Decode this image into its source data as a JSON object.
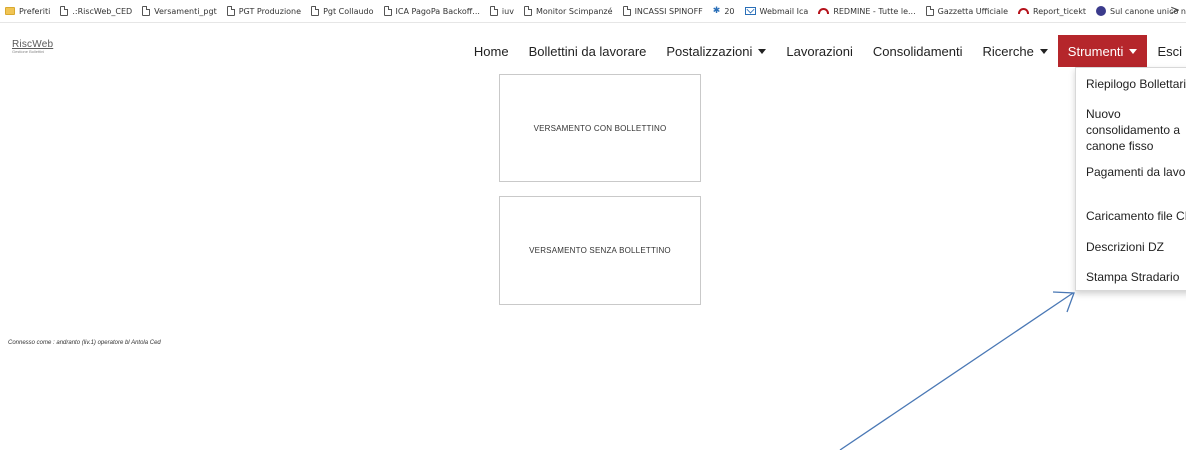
{
  "bookmarks": [
    {
      "label": "Preferiti",
      "icon": "folder-icon"
    },
    {
      "label": ".:RiscWeb_CED",
      "icon": "page-icon"
    },
    {
      "label": "Versamenti_pgt",
      "icon": "page-icon"
    },
    {
      "label": "PGT Produzione",
      "icon": "page-icon"
    },
    {
      "label": "Pgt Collaudo",
      "icon": "page-icon"
    },
    {
      "label": "ICA PagoPa Backoff...",
      "icon": "page-icon"
    },
    {
      "label": "iuv",
      "icon": "page-icon"
    },
    {
      "label": "Monitor Scimpanzé",
      "icon": "page-icon"
    },
    {
      "label": "INCASSI SPINOFF",
      "icon": "page-icon"
    },
    {
      "label": "20",
      "icon": "star-icon"
    },
    {
      "label": "Webmail Ica",
      "icon": "mail-icon"
    },
    {
      "label": "REDMINE - Tutte le...",
      "icon": "redmine-icon"
    },
    {
      "label": "Gazzetta Ufficiale",
      "icon": "page-icon"
    },
    {
      "label": "Report_ticekt",
      "icon": "redmine-icon"
    },
    {
      "label": "Sul canone unico n...",
      "icon": "circle-icon"
    }
  ],
  "bookmarks_more": ">",
  "logo": {
    "main": "RiscWeb",
    "sub": "Gestione Bollettini"
  },
  "nav": {
    "home": "Home",
    "bollettini": "Bollettini da lavorare",
    "postalizzazioni": "Postalizzazioni",
    "lavorazioni": "Lavorazioni",
    "consolidamenti": "Consolidamenti",
    "ricerche": "Ricerche",
    "strumenti": "Strumenti",
    "esci": "Esci"
  },
  "dropdown": [
    "Riepilogo Bollettari",
    "Nuovo consolidamento a canone fisso",
    "Pagamenti da lavorare",
    "Caricamento file CBI",
    "Descrizioni DZ",
    "Stampa Stradario"
  ],
  "cards": {
    "con": "VERSAMENTO CON BOLLETTINO",
    "senza": "VERSAMENTO SENZA BOLLETTINO"
  },
  "status": "Connesso come : andranto (liv.1) operatore bl Antola Ced",
  "colors": {
    "accent": "#b5262b",
    "arrow": "#4a78b5"
  }
}
